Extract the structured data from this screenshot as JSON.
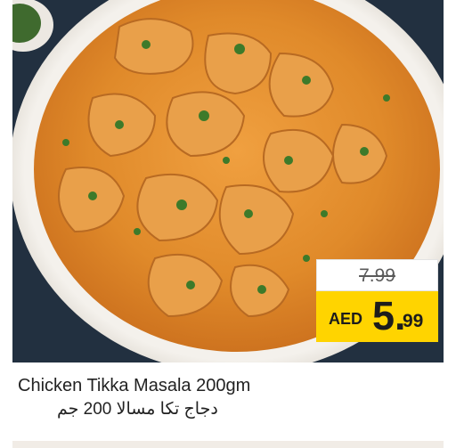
{
  "product": {
    "name_en": "Chicken Tikka Masala 200gm",
    "name_ar": "دجاج تكا مسالا 200 جم",
    "image_alt": "chicken-tikka-masala-photo"
  },
  "price": {
    "old": "7.99",
    "currency": "AED",
    "new_integer": "5.",
    "new_decimal": "99"
  },
  "colors": {
    "price_tag": "#ffd400",
    "text": "#222222"
  }
}
